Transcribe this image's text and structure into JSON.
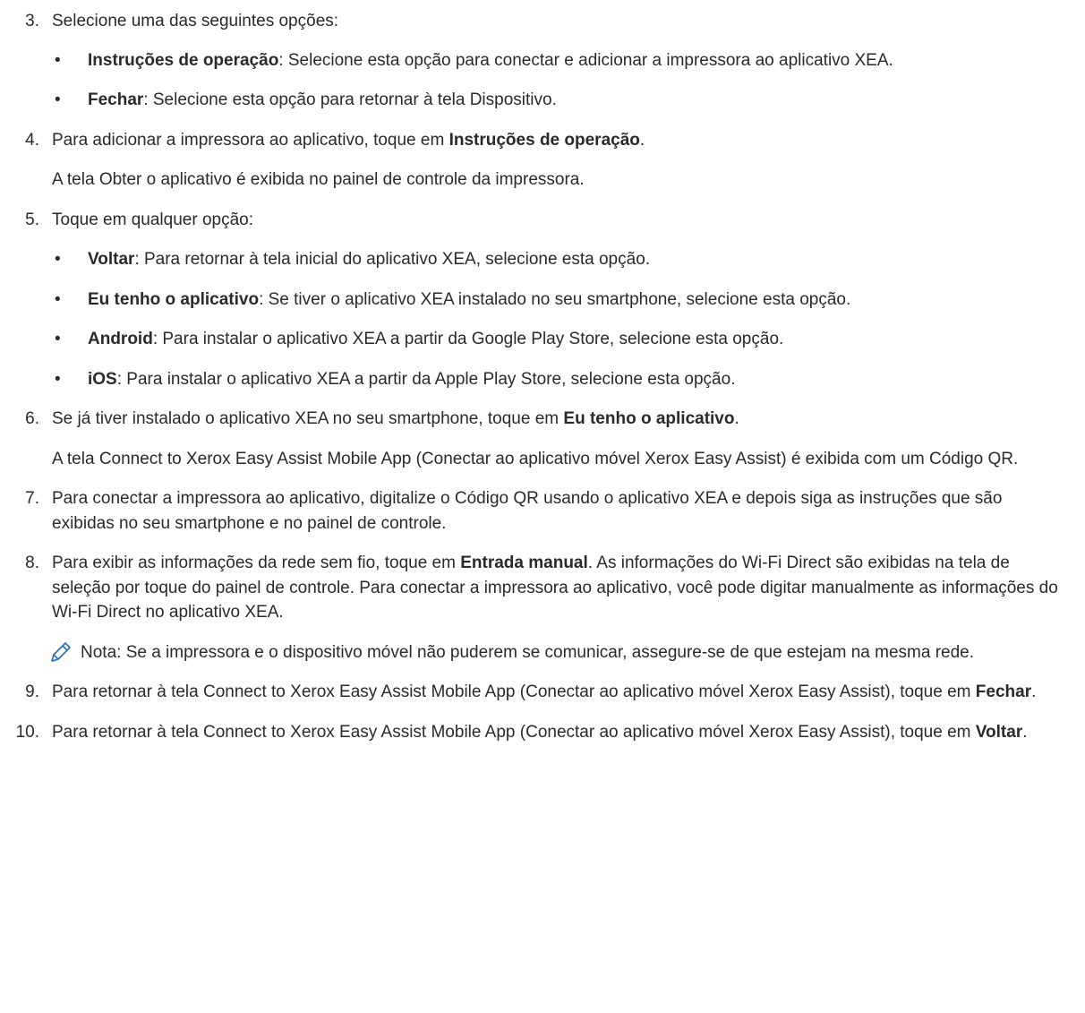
{
  "steps": [
    {
      "num": "3.",
      "text": "Selecione uma das seguintes opções:"
    },
    {
      "num": "4.",
      "pre": "Para adicionar a impressora ao aplicativo, toque em ",
      "bold": "Instruções de operação",
      "post": "."
    },
    {
      "follow4": "A tela Obter o aplicativo é exibida no painel de controle da impressora."
    },
    {
      "num": "5.",
      "text": "Toque em qualquer opção:"
    },
    {
      "num": "6.",
      "pre": "Se já tiver instalado o aplicativo XEA no seu smartphone, toque em ",
      "bold": "Eu tenho o aplicativo",
      "post": "."
    },
    {
      "follow6": "A tela Connect to Xerox Easy Assist Mobile App (Conectar ao aplicativo móvel Xerox Easy Assist) é exibida com um Código QR."
    },
    {
      "num": "7.",
      "text": "Para conectar a impressora ao aplicativo, digitalize o Código QR usando o aplicativo XEA e depois siga as instruções que são exibidas no seu smartphone e no painel de controle."
    },
    {
      "num": "8.",
      "pre": "Para exibir as informações da rede sem fio, toque em ",
      "bold": "Entrada manual",
      "post": ". As informações do Wi-Fi Direct são exibidas na tela de seleção por toque do painel de controle. Para conectar a impressora ao aplicativo, você pode digitar manualmente as informações do Wi-Fi Direct no aplicativo XEA."
    },
    {
      "num": "9.",
      "pre": "Para retornar à tela Connect to Xerox Easy Assist Mobile App (Conectar ao aplicativo móvel Xerox Easy Assist), toque em ",
      "bold": "Fechar",
      "post": "."
    },
    {
      "num": "10.",
      "pre": "Para retornar à tela Connect to Xerox Easy Assist Mobile App (Conectar ao aplicativo móvel Xerox Easy Assist), toque em ",
      "bold": "Voltar",
      "post": "."
    }
  ],
  "bullets_step3": [
    {
      "bold": "Instruções de operação",
      "text": ": Selecione esta opção para conectar e adicionar a impressora ao aplicativo XEA."
    },
    {
      "bold": "Fechar",
      "text": ": Selecione esta opção para retornar à tela Dispositivo."
    }
  ],
  "bullets_step5": [
    {
      "bold": "Voltar",
      "text": ": Para retornar à tela inicial do aplicativo XEA, selecione esta opção."
    },
    {
      "bold": "Eu tenho o aplicativo",
      "text": ": Se tiver o aplicativo XEA instalado no seu smartphone, selecione esta opção."
    },
    {
      "bold": "Android",
      "text": ": Para instalar o aplicativo XEA a partir da Google Play Store, selecione esta opção."
    },
    {
      "bold": "iOS",
      "text": ": Para instalar o aplicativo XEA a partir da Apple Play Store, selecione esta opção."
    }
  ],
  "bullet_char": "•",
  "note": {
    "text": "Nota: Se a impressora e o dispositivo móvel não puderem se comunicar, assegure-se de que estejam na mesma rede.",
    "icon": "pencil-icon",
    "icon_color": "#2a6ebb"
  }
}
